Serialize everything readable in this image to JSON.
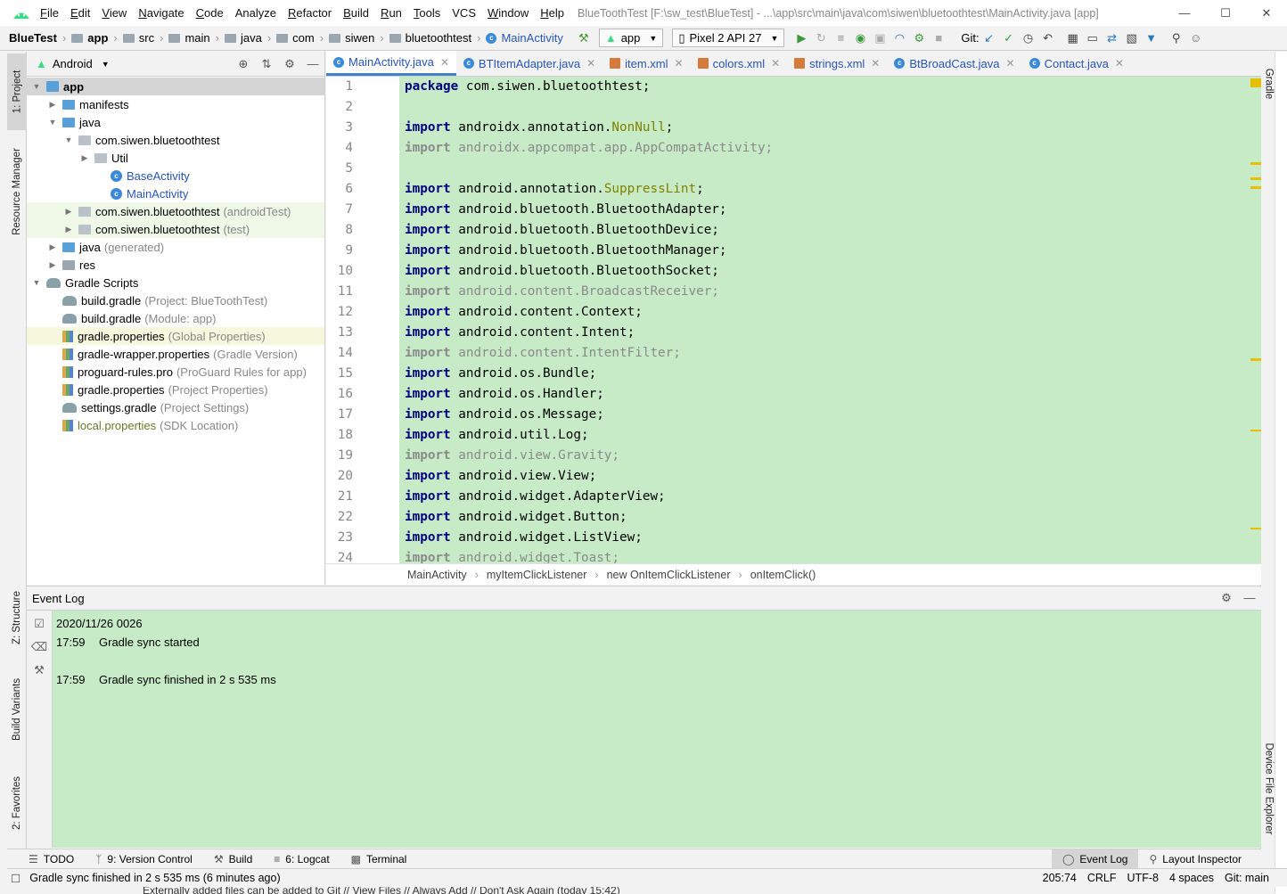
{
  "menu": {
    "items": [
      {
        "u": "F",
        "rest": "ile"
      },
      {
        "u": "E",
        "rest": "dit"
      },
      {
        "u": "V",
        "rest": "iew"
      },
      {
        "u": "N",
        "rest": "avigate"
      },
      {
        "u": "C",
        "rest": "ode"
      },
      {
        "u": "",
        "rest": "Analyze"
      },
      {
        "u": "R",
        "rest": "efactor"
      },
      {
        "u": "B",
        "rest": "uild"
      },
      {
        "u": "R",
        "rest": "un"
      },
      {
        "u": "T",
        "rest": "ools"
      },
      {
        "u": "",
        "rest": "VCS"
      },
      {
        "u": "W",
        "rest": "indow"
      },
      {
        "u": "H",
        "rest": "elp"
      }
    ],
    "window_title": "BlueToothTest [F:\\sw_test\\BlueTest] - ...\\app\\src\\main\\java\\com\\siwen\\bluetoothtest\\MainActivity.java [app]"
  },
  "toolbar": {
    "breadcrumb": [
      "BlueTest",
      "app",
      "src",
      "main",
      "java",
      "com",
      "siwen",
      "bluetoothtest",
      "MainActivity"
    ],
    "run_config": "app",
    "device": "Pixel 2 API 27",
    "git_label": "Git:"
  },
  "left_strip": {
    "project": "1: Project",
    "resource_manager": "Resource Manager",
    "structure": "Z: Structure",
    "build_variants": "Build Variants",
    "favorites": "2: Favorites"
  },
  "right_strip": {
    "gradle": "Gradle",
    "device_file_explorer": "Device File Explorer"
  },
  "project_panel": {
    "view_mode": "Android",
    "tree": [
      {
        "label": "app",
        "hint": "",
        "icon": "app-folder-icon",
        "indent": 0,
        "twisty": "▼",
        "state": "sel",
        "bold": true
      },
      {
        "label": "manifests",
        "hint": "",
        "icon": "folder-icon",
        "indent": 1,
        "twisty": "▶",
        "state": ""
      },
      {
        "label": "java",
        "hint": "",
        "icon": "folder-icon",
        "indent": 1,
        "twisty": "▼",
        "state": ""
      },
      {
        "label": "com.siwen.bluetoothtest",
        "hint": "",
        "icon": "package-icon",
        "indent": 2,
        "twisty": "▼",
        "state": ""
      },
      {
        "label": "Util",
        "hint": "",
        "icon": "package-icon",
        "indent": 3,
        "twisty": "▶",
        "state": ""
      },
      {
        "label": "BaseActivity",
        "hint": "",
        "icon": "class-icon",
        "indent": 4,
        "twisty": "",
        "state": "",
        "blue": true
      },
      {
        "label": "MainActivity",
        "hint": "",
        "icon": "class-icon",
        "indent": 4,
        "twisty": "",
        "state": "",
        "blue": true
      },
      {
        "label": "com.siwen.bluetoothtest",
        "hint": "(androidTest)",
        "icon": "package-icon",
        "indent": 2,
        "twisty": "▶",
        "state": "test"
      },
      {
        "label": "com.siwen.bluetoothtest",
        "hint": "(test)",
        "icon": "package-icon",
        "indent": 2,
        "twisty": "▶",
        "state": "test"
      },
      {
        "label": "java",
        "hint": "(generated)",
        "icon": "folder-icon",
        "indent": 1,
        "twisty": "▶",
        "state": ""
      },
      {
        "label": "res",
        "hint": "",
        "icon": "folder-icon",
        "indent": 1,
        "twisty": "▶",
        "state": ""
      },
      {
        "label": "Gradle Scripts",
        "hint": "",
        "icon": "gradle-icon",
        "indent": 0,
        "twisty": "▼",
        "state": ""
      },
      {
        "label": "build.gradle",
        "hint": "(Project: BlueToothTest)",
        "icon": "gradle-icon",
        "indent": 1,
        "twisty": "",
        "state": ""
      },
      {
        "label": "build.gradle",
        "hint": "(Module: app)",
        "icon": "gradle-icon",
        "indent": 1,
        "twisty": "",
        "state": ""
      },
      {
        "label": "gradle.properties",
        "hint": "(Global Properties)",
        "icon": "properties-icon",
        "indent": 1,
        "twisty": "",
        "state": "hl"
      },
      {
        "label": "gradle-wrapper.properties",
        "hint": "(Gradle Version)",
        "icon": "properties-icon",
        "indent": 1,
        "twisty": "",
        "state": ""
      },
      {
        "label": "proguard-rules.pro",
        "hint": "(ProGuard Rules for app)",
        "icon": "properties-icon",
        "indent": 1,
        "twisty": "",
        "state": ""
      },
      {
        "label": "gradle.properties",
        "hint": "(Project Properties)",
        "icon": "properties-icon",
        "indent": 1,
        "twisty": "",
        "state": ""
      },
      {
        "label": "settings.gradle",
        "hint": "(Project Settings)",
        "icon": "gradle-icon",
        "indent": 1,
        "twisty": "",
        "state": ""
      },
      {
        "label": "local.properties",
        "hint": "(SDK Location)",
        "icon": "properties-icon",
        "indent": 1,
        "twisty": "",
        "state": "",
        "olive": true
      }
    ]
  },
  "editor_tabs": [
    {
      "label": "MainActivity.java",
      "icon": "class-icon",
      "active": true
    },
    {
      "label": "BTItemAdapter.java",
      "icon": "class-icon",
      "active": false
    },
    {
      "label": "item.xml",
      "icon": "xml-icon",
      "active": false
    },
    {
      "label": "colors.xml",
      "icon": "xml-icon",
      "active": false
    },
    {
      "label": "strings.xml",
      "icon": "xml-icon",
      "active": false
    },
    {
      "label": "BtBroadCast.java",
      "icon": "class-icon",
      "active": false
    },
    {
      "label": "Contact.java",
      "icon": "class-icon",
      "active": false
    }
  ],
  "code": [
    {
      "kw": "package",
      "rest": " com.siwen.bluetoothtest;",
      "unused": false
    },
    {
      "kw": "",
      "rest": "",
      "unused": false
    },
    {
      "kw": "import",
      "rest": " androidx.annotation.",
      "anno": "NonNull",
      "tail": ";",
      "unused": false
    },
    {
      "kw": "import",
      "rest": " androidx.appcompat.app.AppCompatActivity;",
      "unused": true
    },
    {
      "kw": "",
      "rest": "",
      "unused": false
    },
    {
      "kw": "import",
      "rest": " android.annotation.",
      "anno": "SuppressLint",
      "tail": ";",
      "unused": false
    },
    {
      "kw": "import",
      "rest": " android.bluetooth.BluetoothAdapter;",
      "unused": false
    },
    {
      "kw": "import",
      "rest": " android.bluetooth.BluetoothDevice;",
      "unused": false
    },
    {
      "kw": "import",
      "rest": " android.bluetooth.BluetoothManager;",
      "unused": false
    },
    {
      "kw": "import",
      "rest": " android.bluetooth.BluetoothSocket;",
      "unused": false
    },
    {
      "kw": "import",
      "rest": " android.content.BroadcastReceiver;",
      "unused": true
    },
    {
      "kw": "import",
      "rest": " android.content.Context;",
      "unused": false
    },
    {
      "kw": "import",
      "rest": " android.content.Intent;",
      "unused": false
    },
    {
      "kw": "import",
      "rest": " android.content.IntentFilter;",
      "unused": true
    },
    {
      "kw": "import",
      "rest": " android.os.Bundle;",
      "unused": false
    },
    {
      "kw": "import",
      "rest": " android.os.Handler;",
      "unused": false
    },
    {
      "kw": "import",
      "rest": " android.os.Message;",
      "unused": false
    },
    {
      "kw": "import",
      "rest": " android.util.Log;",
      "unused": false
    },
    {
      "kw": "import",
      "rest": " android.view.Gravity;",
      "unused": true
    },
    {
      "kw": "import",
      "rest": " android.view.View;",
      "unused": false
    },
    {
      "kw": "import",
      "rest": " android.widget.AdapterView;",
      "unused": false
    },
    {
      "kw": "import",
      "rest": " android.widget.Button;",
      "unused": false
    },
    {
      "kw": "import",
      "rest": " android.widget.ListView;",
      "unused": false
    },
    {
      "kw": "import",
      "rest": " android.widget.Toast;",
      "unused": true
    }
  ],
  "code_breadcrumb": [
    "MainActivity",
    "myItemClickListener",
    "new OnItemClickListener",
    "onItemClick()"
  ],
  "event_log": {
    "title": "Event Log",
    "entries": [
      {
        "time": "",
        "text": "2020/11/26 0026"
      },
      {
        "time": "17:59",
        "text": "Gradle sync started"
      },
      {
        "time": "",
        "text": ""
      },
      {
        "time": "17:59",
        "text": "Gradle sync finished in 2 s 535 ms"
      }
    ]
  },
  "bottom_tabs": {
    "todo": "TODO",
    "version_control": "9: Version Control",
    "build": "Build",
    "logcat": "6: Logcat",
    "terminal": "Terminal",
    "event_log": "Event Log",
    "layout_inspector": "Layout Inspector"
  },
  "status": {
    "message": "Gradle sync finished in 2 s 535 ms (6 minutes ago)",
    "position": "205:74",
    "line_sep": "CRLF",
    "encoding": "UTF-8",
    "indent": "4 spaces",
    "vcs": "Git: main"
  },
  "notification": "Externally added files can be added to Git // View Files // Always Add // Don't Ask Again (today 15:42)",
  "colors": {
    "editor_bg": "#c7ebc7",
    "keyword": "#000080",
    "annotation": "#808000",
    "warning_mark": "#e6c000",
    "selection": "#d5d5d5"
  }
}
